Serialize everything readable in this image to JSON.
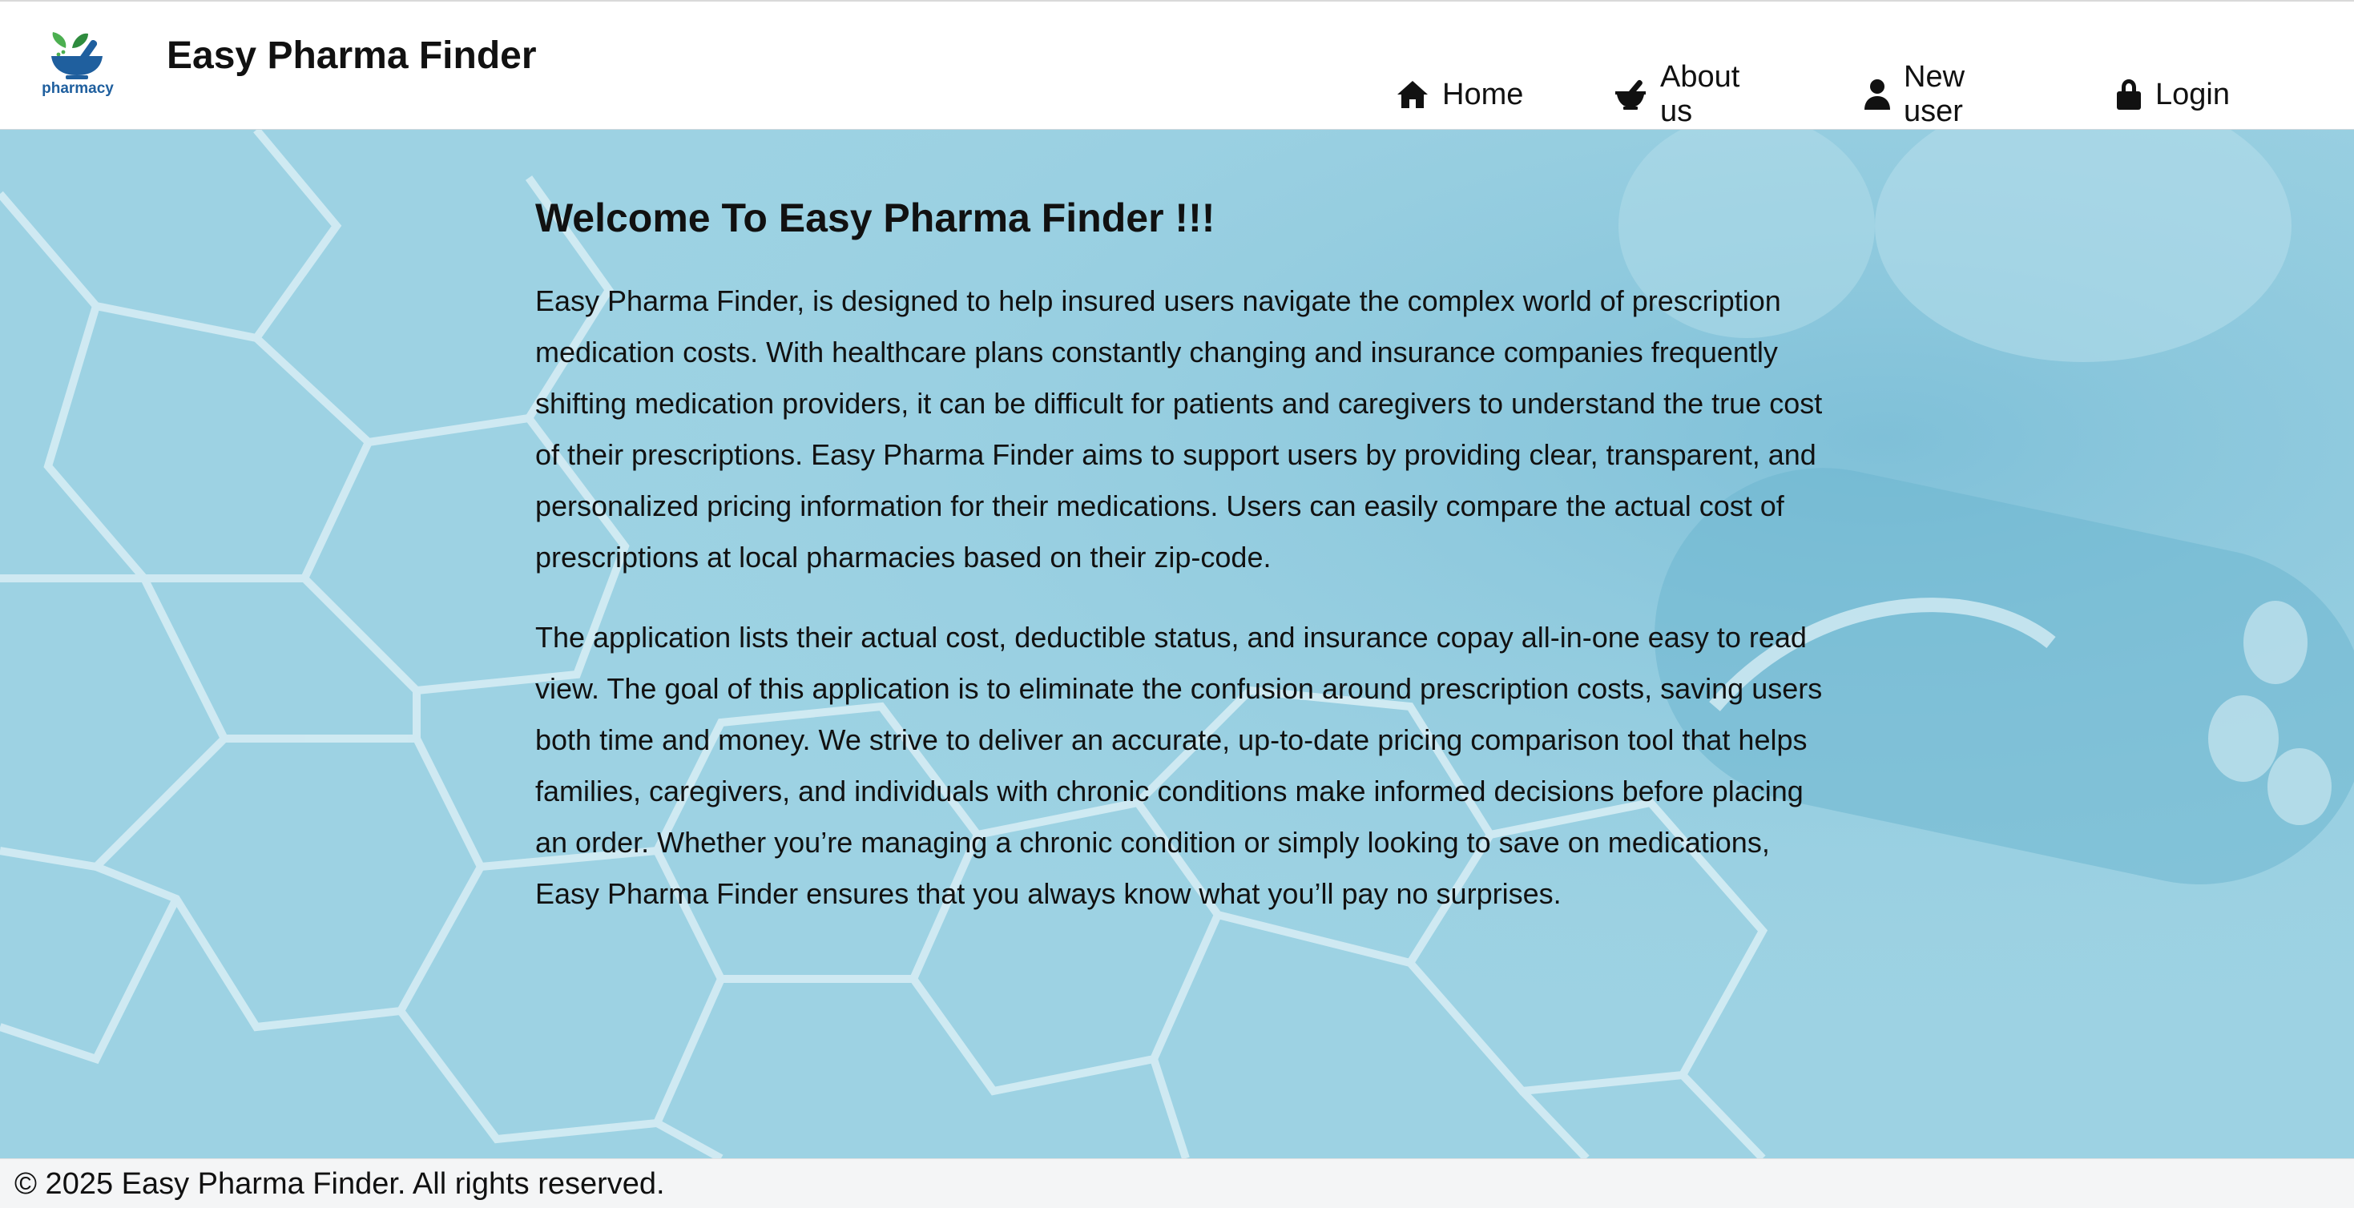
{
  "header": {
    "logo_text": "pharmacy",
    "brand": "Easy Pharma Finder"
  },
  "nav": [
    {
      "label": "Home",
      "icon": "home-icon"
    },
    {
      "label": "About us",
      "icon": "mortar-pestle-icon"
    },
    {
      "label": "New user",
      "icon": "user-icon"
    },
    {
      "label": "Login",
      "icon": "lock-icon"
    }
  ],
  "main": {
    "title": "Welcome To Easy Pharma Finder !!!",
    "paragraphs": [
      "Easy Pharma Finder, is designed to help insured users navigate the complex world of prescription medication costs. With healthcare plans constantly changing and insurance companies frequently shifting medication providers, it can be difficult for patients and caregivers to understand the true cost of their prescriptions. Easy Pharma Finder aims to support users by providing clear, transparent, and personalized pricing information for their medications. Users can easily compare the actual cost of prescriptions at local pharmacies based on their zip-code.",
      "The application lists their actual cost, deductible status, and insurance copay all-in-one easy to read view. The goal of this application is to eliminate the confusion around prescription costs, saving users both time and money. We strive to deliver an accurate, up-to-date pricing comparison tool that helps families, caregivers, and individuals with chronic conditions make informed decisions before placing an order. Whether you’re managing a chronic condition or simply looking to save on medications, Easy Pharma Finder ensures that you always know what you’ll pay no surprises."
    ]
  },
  "footer": {
    "copyright": "© 2025 Easy Pharma Finder. All rights reserved."
  },
  "colors": {
    "hero_background": "#9cd1e2",
    "logo_green": "#4caf50",
    "logo_blue": "#1f5f9e"
  }
}
